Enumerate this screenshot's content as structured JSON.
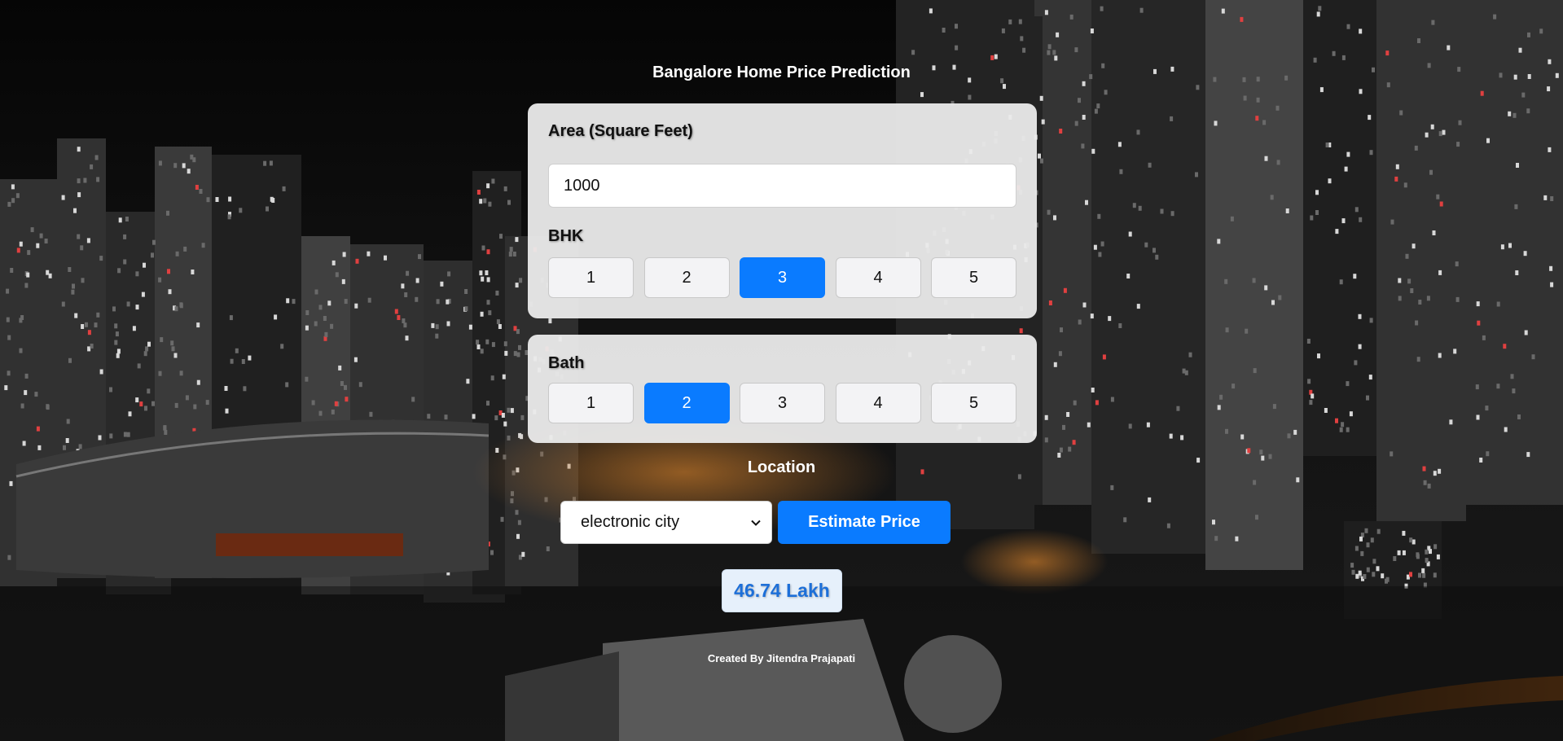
{
  "page": {
    "title": "Bangalore Home Price Prediction",
    "footer": "Created By Jitendra Prajapati"
  },
  "area": {
    "label": "Area (Square Feet)",
    "value": "1000"
  },
  "bhk": {
    "label": "BHK",
    "options": [
      "1",
      "2",
      "3",
      "4",
      "5"
    ],
    "selected": "3"
  },
  "bath": {
    "label": "Bath",
    "options": [
      "1",
      "2",
      "3",
      "4",
      "5"
    ],
    "selected": "2"
  },
  "location": {
    "label": "Location",
    "selected": "electronic city"
  },
  "estimate_button": "Estimate Price",
  "result": "46.74 Lakh",
  "colors": {
    "accent": "#0a7bff",
    "card": "#ebebeb",
    "result_text": "#1d6fd8"
  }
}
